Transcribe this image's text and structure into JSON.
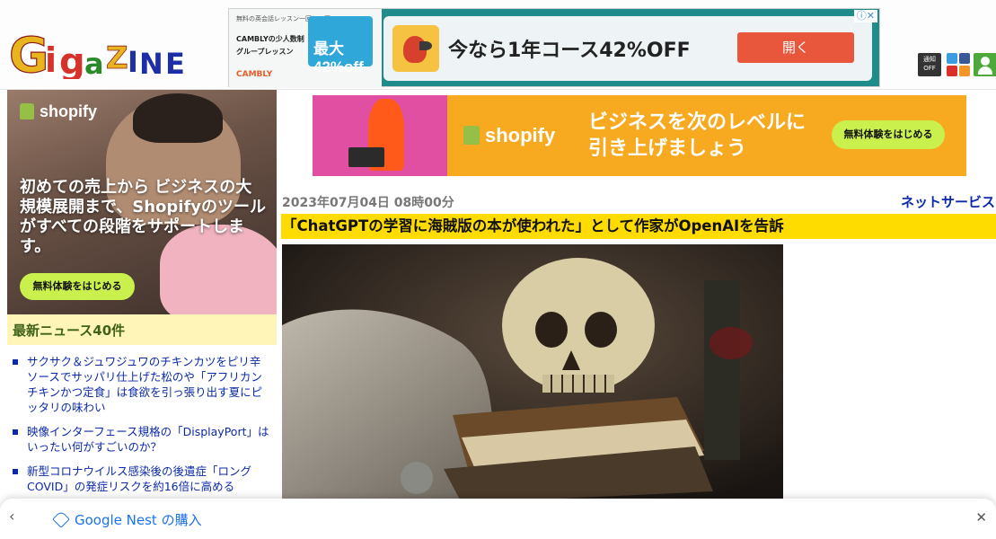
{
  "header": {
    "logo_text": "GIGAZINE",
    "top_ad": {
      "left_caption": "無料の英会話レッスン一回に一回",
      "left_line1": "CAMBLYの少人数制",
      "left_line2": "グループレッスン",
      "discount": "最大42%off",
      "brand": "CAMBLY",
      "headline": "今なら1年コース42%OFF",
      "cta": "開く"
    },
    "icons": [
      "notify-icon",
      "twitter-icon",
      "facebook-icon",
      "youtube-icon",
      "rss-icon",
      "user-icon"
    ],
    "notify_label": "通知 OFF"
  },
  "sidebar_ad": {
    "brand": "shopify",
    "copy": "初めての売上から ビジネスの大規模展開まで、Shopifyのツールがすべての段階をサポートします。",
    "cta": "無料体験をはじめる"
  },
  "latest_news": {
    "heading": "最新ニュース40件",
    "items": [
      "サクサク＆ジュワジュワのチキンカツをピリ辛ソースでサッパリ仕上げた松のや「アフリカンチキンかつ定食」は食欲を引っ張り出す夏にピッタリの味わい",
      "映像インターフェース規格の「DisplayPort」はいったい何がすごいのか？",
      "新型コロナウイルス感染後の後遺症「ロングCOVID」の発症リスクを約16倍に高める"
    ]
  },
  "main_ad": {
    "brand": "shopify",
    "copy": "ビジネスを次のレベルに引き上げましょう",
    "cta": "無料体験をはじめる"
  },
  "article": {
    "datetime": "2023年07月04日 08時00分",
    "category": "ネットサービス",
    "title": "「ChatGPTの学習に海賊版の本が使われた」として作家がOpenAIを告訴"
  },
  "shopping_bar": {
    "label": "Google Nest の購入"
  },
  "colors": {
    "title_bar": "#ffdc00",
    "latest_heading_bg": "#fff5b8",
    "link": "#0b2aa9",
    "shopify_cta": "#c9f04c"
  }
}
